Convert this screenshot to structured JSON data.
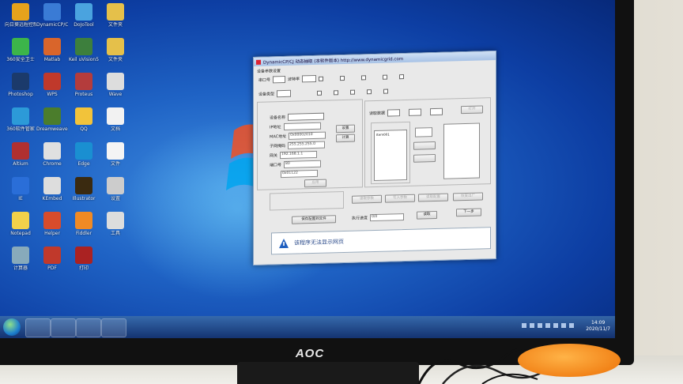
{
  "monitor": {
    "brand": "AOC"
  },
  "desktop_icons": [
    {
      "label": "向日葵远程控制",
      "color": "#e6a21c"
    },
    {
      "label": "DynamicCP/CJ",
      "color": "#3a7bd5"
    },
    {
      "label": "DoJoTool",
      "color": "#4aa3df"
    },
    {
      "label": "文件夹",
      "color": "#e5c04a"
    },
    {
      "label": "360安全卫士",
      "color": "#3cb54a"
    },
    {
      "label": "Matlab",
      "color": "#d9652b"
    },
    {
      "label": "Keil uVision5",
      "color": "#3d7f3d"
    },
    {
      "label": "文件夹",
      "color": "#e5c04a"
    },
    {
      "label": "Photoshop",
      "color": "#1b3a6b"
    },
    {
      "label": "WPS",
      "color": "#c0392b"
    },
    {
      "label": "Proteus",
      "color": "#b43c3c"
    },
    {
      "label": "Wave",
      "color": "#ddd"
    },
    {
      "label": "360软件管家",
      "color": "#2c9ad8"
    },
    {
      "label": "Dreamweaver",
      "color": "#4b7d2c"
    },
    {
      "label": "QQ",
      "color": "#f2c33a"
    },
    {
      "label": "文档",
      "color": "#f2f2f2"
    },
    {
      "label": "Altium",
      "color": "#b03030"
    },
    {
      "label": "Chrome",
      "color": "#e0e0e0"
    },
    {
      "label": "Edge",
      "color": "#1a8fd1"
    },
    {
      "label": "文件",
      "color": "#f4f4f4"
    },
    {
      "label": "IE",
      "color": "#2a6ed8"
    },
    {
      "label": "KEmbed",
      "color": "#ddd"
    },
    {
      "label": "Illustrator",
      "color": "#3a2a10"
    },
    {
      "label": "设置",
      "color": "#ccc"
    },
    {
      "label": "Notepad",
      "color": "#f2d14a"
    },
    {
      "label": "Helper",
      "color": "#d84c2c"
    },
    {
      "label": "Fiddler",
      "color": "#f08a24"
    },
    {
      "label": "工具",
      "color": "#ddd"
    },
    {
      "label": "计算器",
      "color": "#8ab"
    },
    {
      "label": "PDF",
      "color": "#c0392b"
    },
    {
      "label": "打印",
      "color": "#aa2222"
    }
  ],
  "dialog": {
    "title": "DynamicCP/CJ 动态抽取 (本软件版本) http://www.dynamicgrid.com",
    "labels": {
      "group_top": "设备参数设置",
      "com_port": "串口号",
      "baud": "波特率",
      "device": "设备类型",
      "cfg_group": "参数设置",
      "name": "设备名称",
      "ip": "IP地址",
      "mac": "MAC地址",
      "mask": "子网掩码",
      "gateway": "网关",
      "port": "端口号",
      "right_group": "读取数据",
      "list_group": "列表",
      "progress_label": "执行进度",
      "note_label": "提示"
    },
    "fields": {
      "mac": "0x00002010",
      "mask": "255.255.255.0",
      "gateway": "192.168.1.1",
      "port": "80",
      "serial": "0x01122",
      "progress_value": "0/0",
      "list_item": "Item001"
    },
    "buttons": {
      "read": "读取",
      "write": "写入",
      "set": "设置",
      "calc": "计算",
      "open": "打开",
      "apply": "应用",
      "save": "保存配置到文件",
      "load": "读取",
      "next": "下一步",
      "b1": "读取参数",
      "b2": "写入参数",
      "b3": "读取配置",
      "b4": "恢复出厂"
    },
    "message": "该程序无法显示网页"
  },
  "taskbar": {
    "time": "14:09",
    "date": "2020/11/7"
  }
}
